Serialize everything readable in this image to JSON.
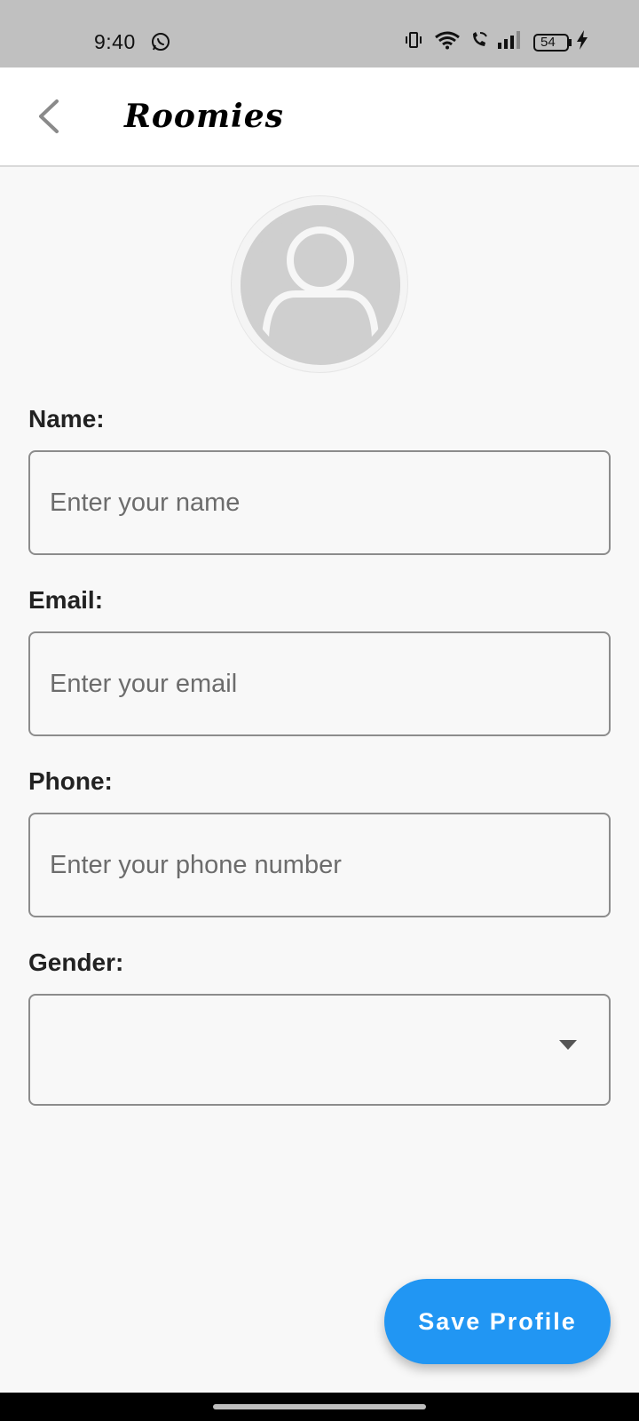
{
  "status_bar": {
    "time": "9:40",
    "battery": "54",
    "icons": [
      "whatsapp-icon",
      "vibrate-icon",
      "wifi-icon",
      "wifi-call-icon",
      "signal-icon",
      "battery-icon",
      "charging-icon"
    ]
  },
  "app_bar": {
    "title": "Roomies",
    "back_icon": "chevron-left-icon"
  },
  "avatar": {
    "icon": "person-icon"
  },
  "form": {
    "name": {
      "label": "Name:",
      "value": "",
      "placeholder": "Enter your name"
    },
    "email": {
      "label": "Email:",
      "value": "",
      "placeholder": "Enter your email"
    },
    "phone": {
      "label": "Phone:",
      "value": "",
      "placeholder": "Enter your phone number"
    },
    "gender": {
      "label": "Gender:",
      "selected": ""
    }
  },
  "actions": {
    "save_label": "Save Profile"
  },
  "colors": {
    "accent": "#2196f3",
    "status_bar": "#c0c0c0",
    "background": "#f8f8f8"
  }
}
